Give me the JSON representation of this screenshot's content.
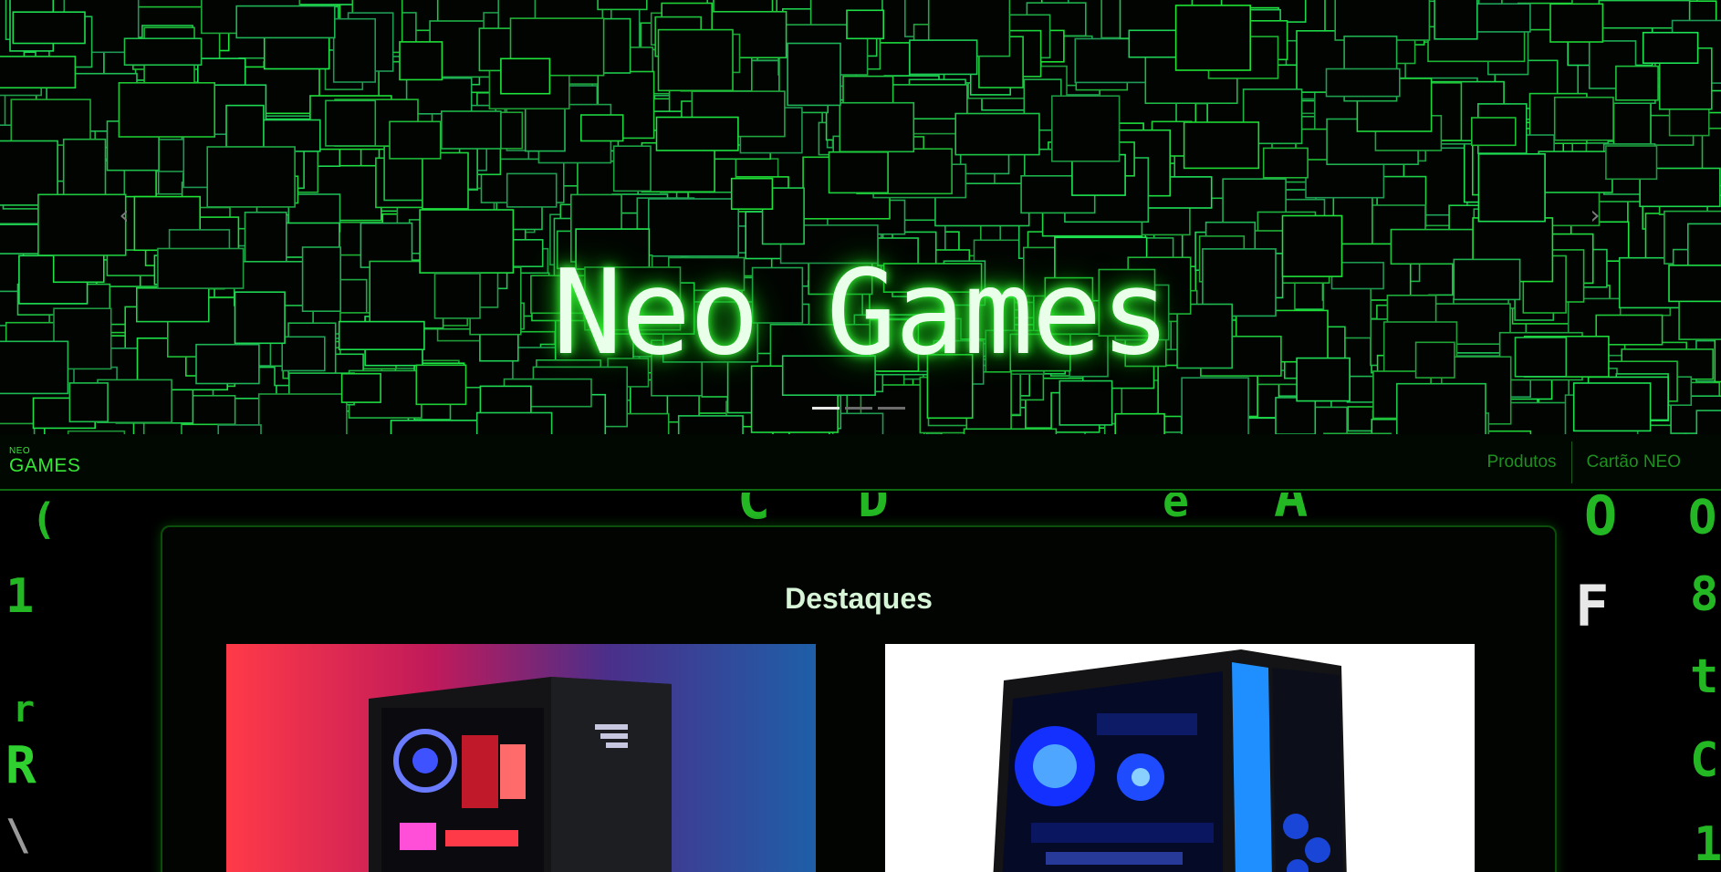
{
  "hero": {
    "title": "Neo Games",
    "prev_icon": "chevron-left-icon",
    "next_icon": "chevron-right-icon",
    "slide_count": 3,
    "active_slide": 1
  },
  "navbar": {
    "brand_small": "NEO",
    "brand_big": "GAMES",
    "links": [
      "Produtos",
      "Cartão NEO"
    ]
  },
  "featured": {
    "title": "Destaques",
    "products": [
      {
        "image": "gaming-pc-red-blue-backdrop"
      },
      {
        "image": "gaming-pc-blue-led-case"
      }
    ]
  },
  "colors": {
    "accent": "#35e835",
    "title_glow": "#39ff39",
    "background": "#000000"
  }
}
